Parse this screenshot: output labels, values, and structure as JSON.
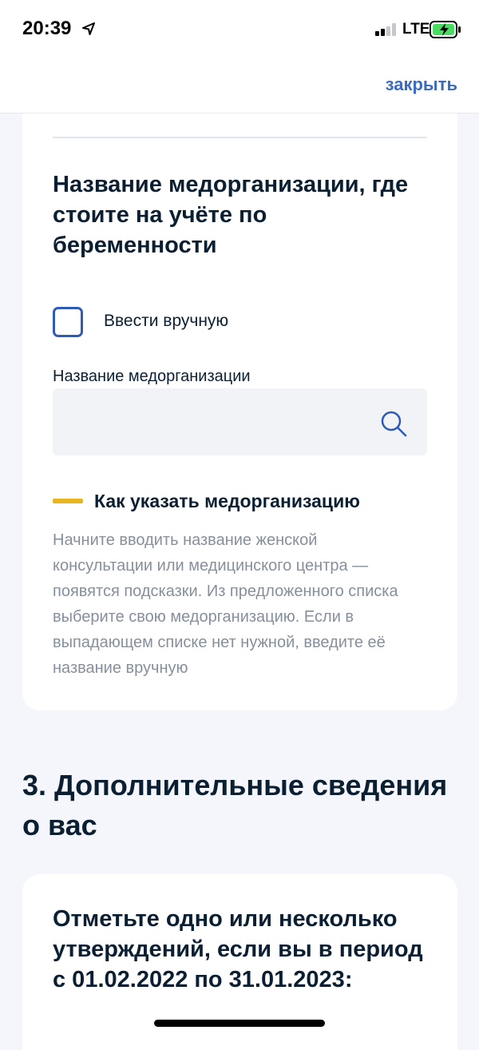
{
  "status_bar": {
    "time": "20:39",
    "network": "LTE"
  },
  "nav": {
    "close_label": "закрыть"
  },
  "card_1": {
    "title": "Название медорганизации, где стоите на учёте по беременности",
    "checkbox_label": "Ввести вручную",
    "checkbox_checked": false,
    "field_label": "Название медорганизации",
    "field_value": "",
    "hint_title": "Как указать медорганизацию",
    "hint_text": "Начните вводить название женской консультации или медицинского центра — появятся подсказки. Из предложенного списка выберите свою медорганизацию. Если в выпадающем списке нет нужной, введите её название вручную"
  },
  "section_3": {
    "heading": "3. Дополнительные сведения о вас",
    "card_title": "Отметьте одно или несколько утверждений, если вы в период с 01.02.2022 по 31.01.2023:"
  },
  "colors": {
    "accent": "#3b6ac1",
    "checkbox_border": "#2d5bb5",
    "hint_marker": "#e8b520",
    "text_primary": "#0b1f33",
    "text_secondary": "#86909c",
    "background": "#f4f6fb"
  },
  "icons": {
    "location": "location-arrow-icon",
    "signal": "signal-icon",
    "battery": "battery-charging-icon",
    "search": "search-icon"
  }
}
